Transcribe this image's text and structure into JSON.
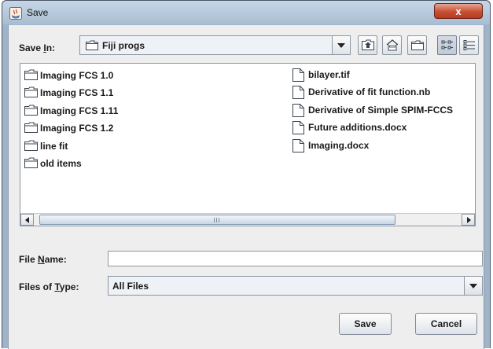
{
  "window": {
    "title": "Save",
    "close_label": "x"
  },
  "save_in": {
    "label_prefix": "Save ",
    "label_mnemonic": "I",
    "label_suffix": "n:",
    "selected": "Fiji progs"
  },
  "toolbar": {
    "icons": [
      "up-one-level-icon",
      "home-icon",
      "new-folder-icon",
      "list-view-icon",
      "details-view-icon"
    ],
    "active_view": "list"
  },
  "file_list": {
    "folders": [
      "Imaging FCS 1.0",
      "Imaging FCS 1.1",
      "Imaging FCS 1.11",
      "Imaging FCS 1.2",
      "line fit",
      "old items"
    ],
    "files": [
      "bilayer.tif",
      "Derivative of fit function.nb",
      "Derivative of Simple SPIM-FCCS",
      "Future additions.docx",
      "Imaging.docx"
    ]
  },
  "file_name": {
    "label_prefix": "File ",
    "label_mnemonic": "N",
    "label_suffix": "ame:",
    "value": ""
  },
  "file_type": {
    "label_prefix": "Files of ",
    "label_mnemonic": "T",
    "label_suffix": "ype:",
    "selected": "All Files"
  },
  "buttons": {
    "save": "Save",
    "cancel": "Cancel"
  },
  "colors": {
    "title_bar": "#b4c7db",
    "close_button": "#c74f33",
    "dialog_bg": "#eeeeee",
    "scroll_thumb": "#c9d6e4"
  }
}
